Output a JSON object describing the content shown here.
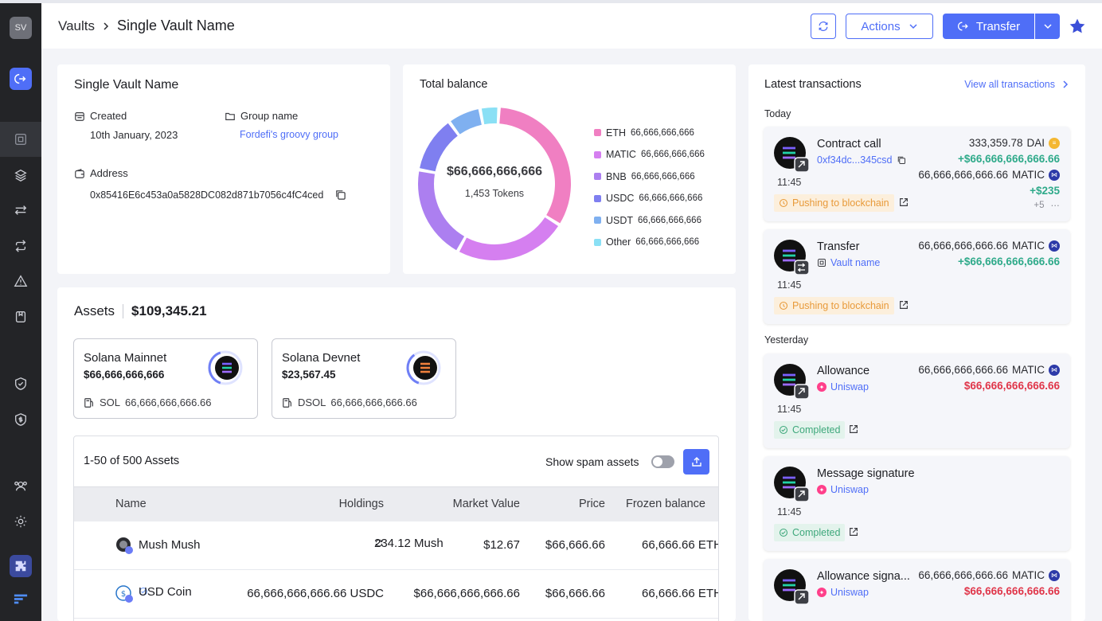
{
  "sidebar": {
    "avatar": "SV",
    "items": [
      "vault-icon",
      "layers-icon",
      "swap-icon",
      "repeat-icon",
      "alert-icon",
      "book-icon",
      "shield-check-icon",
      "shield-dollar-icon",
      "users-icon",
      "gear-icon",
      "puzzle-icon",
      "logo-icon"
    ]
  },
  "header": {
    "crumb_root": "Vaults",
    "crumb_current": "Single Vault Name",
    "actions_label": "Actions",
    "transfer_label": "Transfer"
  },
  "vault": {
    "title": "Single Vault Name",
    "created_label": "Created",
    "created_value": "10th  January, 2023",
    "group_label": "Group name",
    "group_value": "Fordefi's groovy group",
    "address_label": "Address",
    "address_value": "0x85416E6c453a0a5828DC082d871b7056c4fC4ced"
  },
  "balance": {
    "title": "Total balance",
    "total": "$66,666,666,666",
    "tokens": "1,453  Tokens",
    "legend": [
      {
        "name": "ETH",
        "value": "66,666,666,666",
        "color": "#f07fc2"
      },
      {
        "name": "MATIC",
        "value": "66,666,666,666",
        "color": "#d57ff0"
      },
      {
        "name": "BNB",
        "value": "66,666,666,666",
        "color": "#ac7ff0"
      },
      {
        "name": "USDC",
        "value": "66,666,666,666",
        "color": "#7f7ff0"
      },
      {
        "name": "USDT",
        "value": "66,666,666,666",
        "color": "#7fb0f0"
      },
      {
        "name": "Other",
        "value": "66,666,666,666",
        "color": "#8ae0f5"
      }
    ],
    "chart_data": {
      "type": "pie",
      "categories": [
        "ETH",
        "MATIC",
        "BNB",
        "USDC",
        "USDT",
        "Other"
      ],
      "values": [
        33,
        24,
        20,
        12,
        7,
        4
      ]
    }
  },
  "assets": {
    "title": "Assets",
    "total": "$109,345.21",
    "wallets": [
      {
        "name": "Solana Mainnet",
        "balance": "$66,666,666,666",
        "token": "SOL",
        "amount": "66,666,666,666.66",
        "progress": 0.4
      },
      {
        "name": "Solana Devnet",
        "balance": "$23,567.45",
        "token": "DSOL",
        "amount": "66,666,666,666.66",
        "progress": 0.35
      }
    ],
    "range_label": "1-50 of 500 Assets",
    "spam_label": "Show spam assets",
    "columns": [
      "Name",
      "Holdings",
      "Market Value",
      "Price",
      "Frozen balance"
    ],
    "rows": [
      {
        "name": "Mush Mush",
        "holdings": "234.12 Mush",
        "market": "$12.67",
        "price": "$66,666.66",
        "frozen": "66,666.66 ETH"
      },
      {
        "name": "USD Coin",
        "holdings": "66,666,666,666.66 USDC",
        "market": "$66,666,666,666.66",
        "price": "$66,666.66",
        "frozen": "66,666.66 ETH"
      }
    ]
  },
  "transactions": {
    "title": "Latest transactions",
    "view_all": "View all transactions",
    "today": "Today",
    "yesterday": "Yesterday",
    "items": [
      {
        "title": "Contract call",
        "sub": "0xf34dc...345csd",
        "time": "11:45",
        "status": "Pushing to blockchain",
        "a1": "333,359.78",
        "a1_unit": "DAI",
        "a2": "+$66,666,666,666.66",
        "a3": "66,666,666,666.66",
        "a3_unit": "MATIC",
        "a4": "+$235",
        "more": "+5"
      },
      {
        "title": "Transfer",
        "sub": "Vault name",
        "time": "11:45",
        "status": "Pushing to blockchain",
        "a1": "66,666,666,666.66",
        "a1_unit": "MATIC",
        "a2": "+$66,666,666,666.66"
      },
      {
        "title": "Allowance",
        "sub": "Uniswap",
        "time": "11:45",
        "status": "Completed",
        "a1": "66,666,666,666.66",
        "a1_unit": "MATIC",
        "a2": "$66,666,666,666.66"
      },
      {
        "title": "Message signature",
        "sub": "Uniswap",
        "time": "11:45",
        "status": "Completed"
      },
      {
        "title": "Allowance signa...",
        "sub": "Uniswap",
        "a1": "66,666,666,666.66",
        "a1_unit": "MATIC",
        "a2": "$66,666,666,666.66"
      }
    ]
  },
  "colors": {
    "accent": "#4f6ef7",
    "green": "#2faa8a",
    "red": "#e0364a",
    "pending": "#e89a3a"
  }
}
